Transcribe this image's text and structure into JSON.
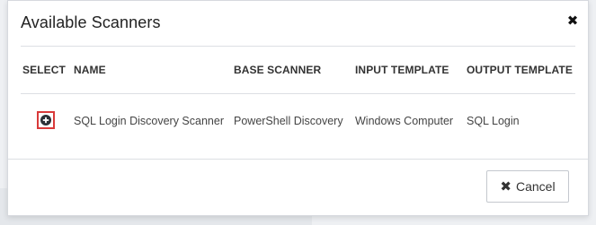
{
  "dialog": {
    "title": "Available Scanners",
    "close_icon": "close-icon"
  },
  "table": {
    "columns": [
      "SELECT",
      "NAME",
      "BASE SCANNER",
      "INPUT TEMPLATE",
      "OUTPUT TEMPLATE"
    ],
    "rows": [
      {
        "select_icon": "plus-circle-icon",
        "name": "SQL Login Discovery Scanner",
        "base_scanner": "PowerShell Discovery",
        "input_template": "Windows Computer",
        "output_template": "SQL Login"
      }
    ]
  },
  "footer": {
    "cancel_label": "Cancel",
    "cancel_icon": "close-icon"
  },
  "colors": {
    "highlight": "#d93a3a",
    "text": "#333333",
    "divider": "#dcdfe3"
  }
}
